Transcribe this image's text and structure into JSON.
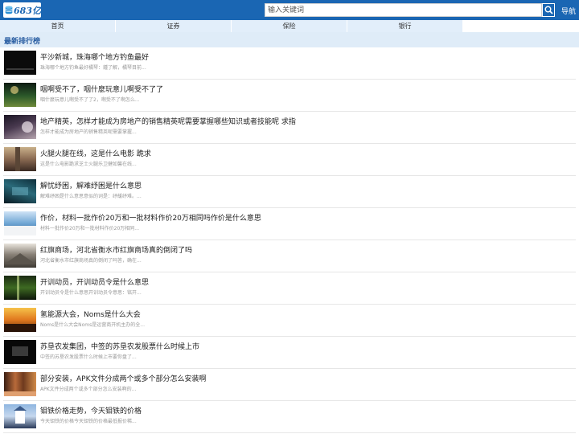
{
  "header": {
    "logo_text": "683亿",
    "search_placeholder": "输入关键词",
    "search_icon": "search-icon",
    "nav_label": "导航"
  },
  "tabs": [
    {
      "label": "首页"
    },
    {
      "label": "证券"
    },
    {
      "label": "保险"
    },
    {
      "label": "银行"
    }
  ],
  "section": {
    "title": "最新排行榜"
  },
  "items": [
    {
      "title": "平沙新城，珠海哪个地方钓鱼最好",
      "desc": "珠海哪个地方钓鱼最好橘琴：鍾了解，橘琴目前..."
    },
    {
      "title": "咽啊受不了，咽什麼玩意儿啊受不了了",
      "desc": "咽什麼玩意儿啊受不了了2，啊受不了啊怎么..."
    },
    {
      "title": "地产精英，怎样才能成为房地产的销售精英呢需要掌握哪些知识或者技能呢 求指",
      "desc": "怎样才能成为房地产的销售精英呢需要掌握..."
    },
    {
      "title": "火腿火腿在线，这是什么电影 跪求",
      "desc": "这是什么电影跪求芝士火腿乐卫健如馨在线..."
    },
    {
      "title": "解忧纾困，解难纾困是什么意思",
      "desc": "解难纾困是什么意思意似的词是：纾緩纾难。..."
    },
    {
      "title": "作价，材料一批作价20万和一批材料作价20万相同吗作价是什么意思",
      "desc": "材料一批作价20万和一批材料作价20万相同..."
    },
    {
      "title": "红旗商场，河北省衡水市红旗商场真的倒闭了吗",
      "desc": "河北省衡水市红旗商场真的倒闭了吗答，确在..."
    },
    {
      "title": "开训动员，开训动员令是什么意思",
      "desc": "开训动员令是什么意思开训动员令意思：铭开..."
    },
    {
      "title": "氢能源大会，Noms是什么大会",
      "desc": "Noms是什么大会Noms是运营商开机主办的全..."
    },
    {
      "title": "苏垦农发集团，中签的苏垦农发股票什么时候上市",
      "desc": "中签的苏垦农发股票什么时候上市要你盘了..."
    },
    {
      "title": "部分安装，APK文件分成两个或多个部分怎么安装啊",
      "desc": "APK文件分成两个或多个部分怎么安装啊的..."
    },
    {
      "title": "钼铁价格走势，今天钼铁的价格",
      "desc": "今天钼铁的价格今天钼铁的价格最低报价稀..."
    }
  ]
}
